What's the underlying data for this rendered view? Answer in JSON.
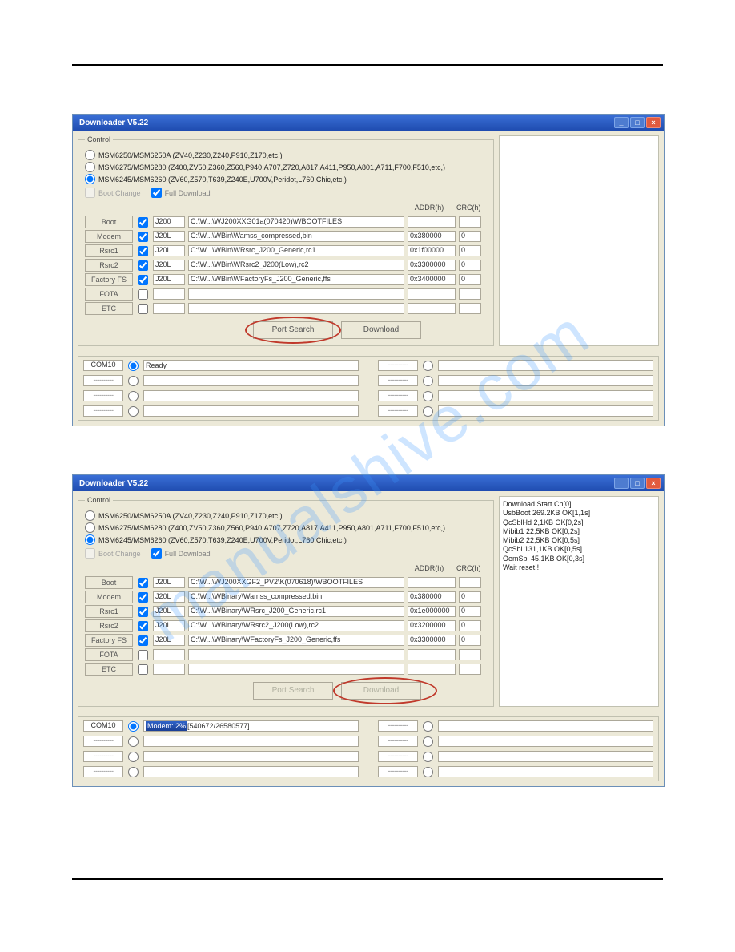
{
  "watermark": "manualshive.com",
  "window": {
    "title": "Downloader V5.22",
    "min": "_",
    "max": "□",
    "close": "×"
  },
  "control": {
    "legend": "Control",
    "radios": [
      {
        "checked": false,
        "label": "MSM6250/MSM6250A (ZV40,Z230,Z240,P910,Z170,etc,)"
      },
      {
        "checked": false,
        "label": "MSM6275/MSM6280 (Z400,ZV50,Z360,Z560,P940,A707,Z720,A817,A411,P950,A801,A711,F700,F510,etc,)"
      },
      {
        "checked": true,
        "label": "MSM6245/MSM6260 (ZV60,Z570,T639,Z240E,U700V,Peridot,L760,Chic,etc,)"
      }
    ],
    "boot_change_label": "Boot Change",
    "full_download_label": "Full Download",
    "full_download_checked": true,
    "addr_header": "ADDR(h)",
    "crc_header": "CRC(h)",
    "port_search_label": "Port Search",
    "download_label": "Download"
  },
  "slots1": [
    {
      "btn": "Boot",
      "chk": true,
      "model": "J200",
      "path": "C:\\W...\\WJ200XXG01a(070420)\\WBOOTFILES",
      "addr": "",
      "crc": ""
    },
    {
      "btn": "Modem",
      "chk": true,
      "model": "J20L",
      "path": "C:\\W...\\WBin\\Wamss_compressed,bin",
      "addr": "0x380000",
      "crc": "0"
    },
    {
      "btn": "Rsrc1",
      "chk": true,
      "model": "J20L",
      "path": "C:\\W...\\WBin\\WRsrc_J200_Generic,rc1",
      "addr": "0x1f00000",
      "crc": "0"
    },
    {
      "btn": "Rsrc2",
      "chk": true,
      "model": "J20L",
      "path": "C:\\W...\\WBin\\WRsrc2_J200(Low),rc2",
      "addr": "0x3300000",
      "crc": "0"
    },
    {
      "btn": "Factory FS",
      "chk": true,
      "model": "J20L",
      "path": "C:\\W...\\WBin\\WFactoryFs_J200_Generic,ffs",
      "addr": "0x3400000",
      "crc": "0"
    },
    {
      "btn": "FOTA",
      "chk": false,
      "model": "",
      "path": "",
      "addr": "",
      "crc": ""
    },
    {
      "btn": "ETC",
      "chk": false,
      "model": "",
      "path": "",
      "addr": "",
      "crc": ""
    }
  ],
  "slots2": [
    {
      "btn": "Boot",
      "chk": true,
      "model": "J20L",
      "path": "C:\\W...\\WJ200XXGF2_PV2\\K(070618)\\WBOOTFILES",
      "addr": "",
      "crc": ""
    },
    {
      "btn": "Modem",
      "chk": true,
      "model": "J20L",
      "path": "C:\\W...\\WBinary\\Wamss_compressed,bin",
      "addr": "0x380000",
      "crc": "0"
    },
    {
      "btn": "Rsrc1",
      "chk": true,
      "model": "J20L",
      "path": "C:\\W...\\WBinary\\WRsrc_J200_Generic,rc1",
      "addr": "0x1e000000",
      "crc": "0"
    },
    {
      "btn": "Rsrc2",
      "chk": true,
      "model": "J20L",
      "path": "C:\\W...\\WBinary\\WRsrc2_J200(Low),rc2",
      "addr": "0x3200000",
      "crc": "0"
    },
    {
      "btn": "Factory FS",
      "chk": true,
      "model": "J20L",
      "path": "C:\\W...\\WBinary\\WFactoryFs_J200_Generic,ffs",
      "addr": "0x3300000",
      "crc": "0"
    },
    {
      "btn": "FOTA",
      "chk": false,
      "model": "",
      "path": "",
      "addr": "",
      "crc": ""
    },
    {
      "btn": "ETC",
      "chk": false,
      "model": "",
      "path": "",
      "addr": "",
      "crc": ""
    }
  ],
  "log2": [
    "Download Start Ch[0]",
    "UsbBoot 269.2KB OK[1,1s]",
    "QcSblHd 2,1KB OK[0,2s]",
    "Mibib1 22,5KB OK[0,2s]",
    "Mibib2 22,5KB OK[0,5s]",
    "QcSbl 131,1KB OK[0,5s]",
    "OemSbl 45,1KB OK[0,3s]",
    "Wait reset!!"
  ],
  "ports1": {
    "com": "COM10",
    "status0": "Ready",
    "dashes": "----------"
  },
  "ports2": {
    "com": "COM10",
    "status0_prog": "Modem:   2%",
    "status0_tail": " [540672/26580577]",
    "dashes": "----------"
  }
}
